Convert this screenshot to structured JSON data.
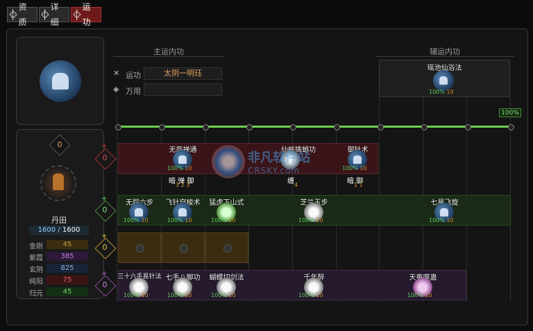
{
  "tabs": [
    {
      "label": "资质"
    },
    {
      "label": "详细"
    },
    {
      "label": "运功"
    }
  ],
  "sections": {
    "main": "主运内功",
    "aux": "辅运内功"
  },
  "yungong": {
    "label": "运功",
    "value": "太阴一明珏"
  },
  "wanyong": {
    "label": "万用",
    "value": ""
  },
  "aux_skill": {
    "name": "瑶池仙浴法",
    "pct": "100%",
    "val": "10"
  },
  "progress_label": "100%",
  "dantian": {
    "count": "0",
    "name": "丹田",
    "current": "1600",
    "max": "1600"
  },
  "attributes": [
    {
      "name": "金刚",
      "value": "45",
      "color": "#b08a30",
      "bg": "#3a2c10"
    },
    {
      "name": "紫霞",
      "value": "385",
      "color": "#b070d0",
      "bg": "#2c1838"
    },
    {
      "name": "玄阴",
      "value": "825",
      "color": "#7aa0d0",
      "bg": "#182436"
    },
    {
      "name": "纯阳",
      "value": "75",
      "color": "#d05050",
      "bg": "#3a1414"
    },
    {
      "name": "归元",
      "value": "45",
      "color": "#60c060",
      "bg": "#143014"
    }
  ],
  "row_badges": [
    {
      "plus": "+",
      "count": "0"
    },
    {
      "plus": "+",
      "count": "0"
    },
    {
      "plus": "+",
      "count": "0"
    },
    {
      "plus": "+",
      "count": "0"
    }
  ],
  "row1": [
    {
      "name": "无怨禅通",
      "pct": "100%",
      "val": "10",
      "tags": "暗 弹 御",
      "sub": "3 2 3"
    },
    {
      "name": "仙蜍擒蛸功",
      "pct": "",
      "val": "",
      "tags": "缠",
      "sub": "4"
    },
    {
      "name": "御针术",
      "pct": "100%",
      "val": "10",
      "tags": "暗 御",
      "sub": "1 1"
    }
  ],
  "row2": [
    {
      "name": "无踪六步",
      "pct": "100%",
      "val": "10"
    },
    {
      "name": "飞针穿梭术",
      "pct": "100%",
      "val": "10"
    },
    {
      "name": "猛虎下山式",
      "pct": "100%",
      "val": "10"
    },
    {
      "name": "芝兰玉步",
      "pct": "100%",
      "val": "10"
    },
    {
      "name": "七星飞旋",
      "pct": "100%",
      "val": "10"
    }
  ],
  "row4": [
    {
      "name": "三十六手易针法",
      "pct": "100%",
      "val": "10"
    },
    {
      "name": "七手八脚功",
      "pct": "100%",
      "val": "10"
    },
    {
      "name": "蝴蝶切剑法",
      "pct": "100%",
      "val": "10"
    },
    {
      "name": "千年醉",
      "pct": "100%",
      "val": "10"
    },
    {
      "name": "天蚕噬蛊",
      "pct": "100%",
      "val": "10"
    }
  ],
  "watermark": {
    "cn": "非凡软件站",
    "en": "CRSKY.com"
  },
  "colors": {
    "active_tab": "#6e1a1a",
    "green": "#5fcf5f",
    "gold": "#e0a060"
  }
}
